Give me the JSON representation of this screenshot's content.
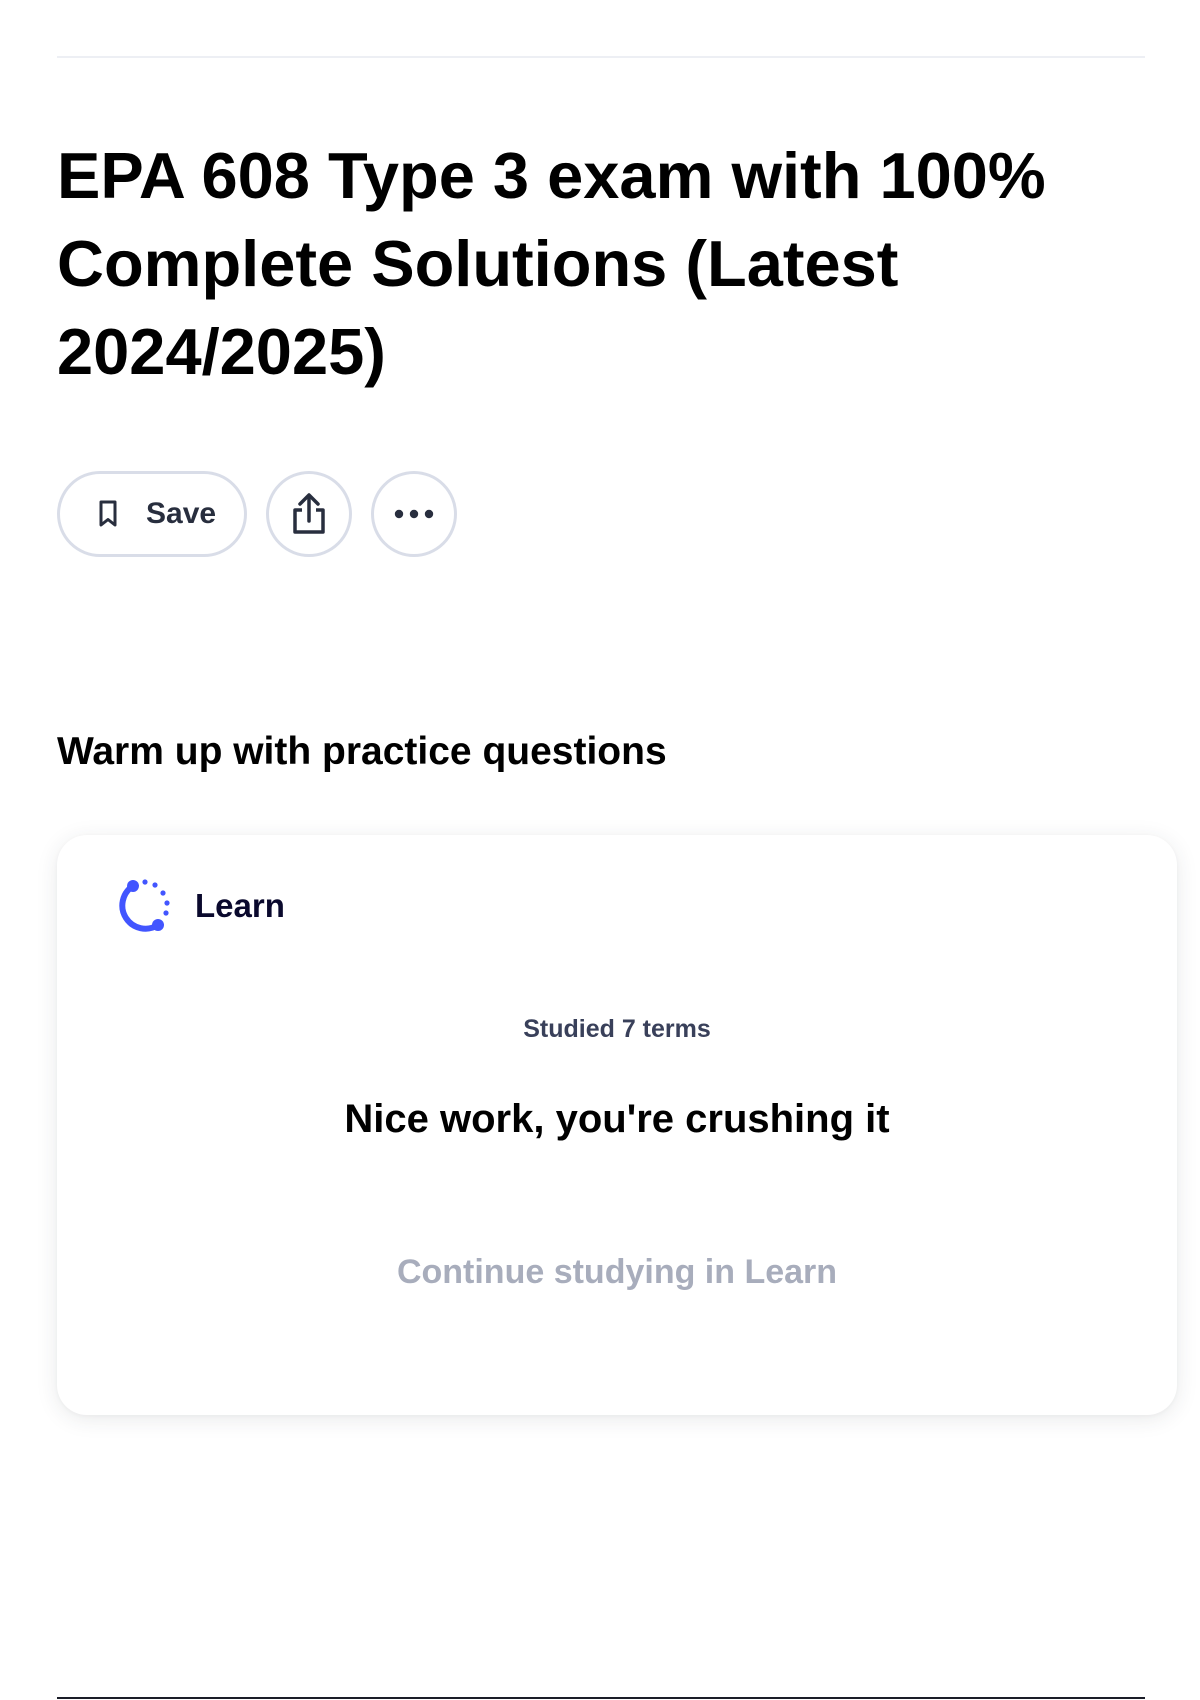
{
  "page": {
    "title": "EPA 608 Type 3 exam with 100% Complete Solutions (Latest 2024/2025)"
  },
  "actions": {
    "save_label": "Save",
    "save_icon": "bookmark-icon",
    "share_icon": "share-icon",
    "more_icon": "more-horizontal-icon"
  },
  "practice": {
    "heading": "Warm up with practice questions",
    "card": {
      "mode_label": "Learn",
      "mode_icon": "learn-icon",
      "studied_text": "Studied 7 terms",
      "message": "Nice work, you're crushing it",
      "continue_label": "Continue studying in Learn"
    }
  },
  "colors": {
    "accent": "#4255ff",
    "border": "#d9dde8",
    "muted_text": "#a8adbc",
    "heading_text": "#000000"
  }
}
